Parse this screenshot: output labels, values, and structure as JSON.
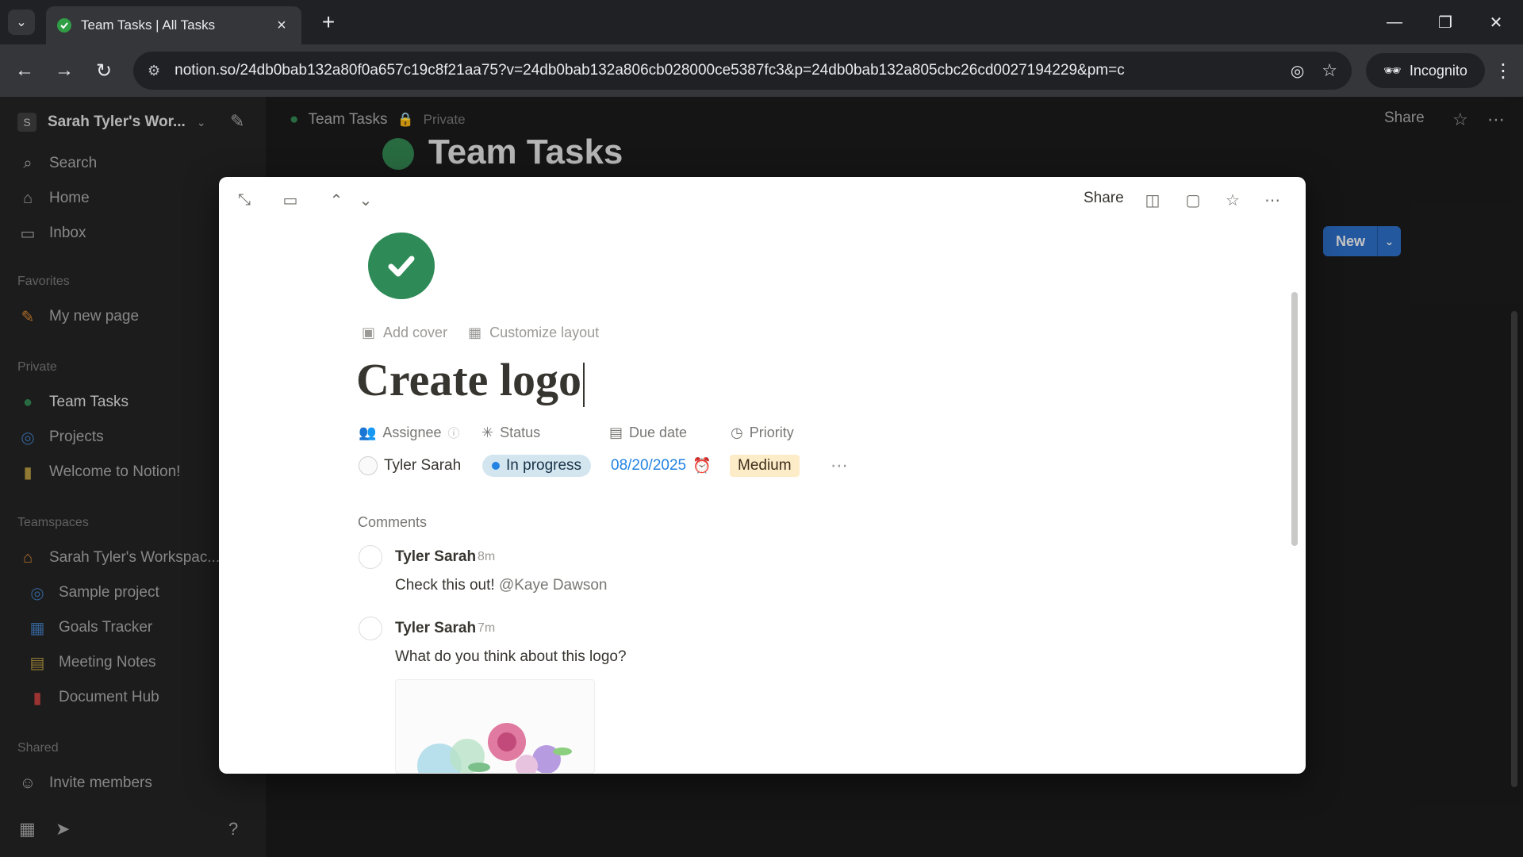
{
  "browser": {
    "tab_title": "Team Tasks | All Tasks",
    "url": "notion.so/24db0bab132a80f0a657c19c8f21aa75?v=24db0bab132a806cb028000ce5387fc3&p=24db0bab132a805cbc26cd0027194229&pm=c",
    "incognito_label": "Incognito"
  },
  "sidebar": {
    "workspace_name": "Sarah Tyler's Wor...",
    "workspace_initial": "S",
    "top_items": [
      {
        "label": "Search",
        "icon": "search-icon"
      },
      {
        "label": "Home",
        "icon": "home-icon"
      },
      {
        "label": "Inbox",
        "icon": "inbox-icon"
      }
    ],
    "favorites_label": "Favorites",
    "favorites": [
      {
        "label": "My new page",
        "icon": "pencil-icon"
      }
    ],
    "private_label": "Private",
    "private_items": [
      {
        "label": "Team Tasks",
        "icon": "check-circle-icon"
      },
      {
        "label": "Projects",
        "icon": "target-icon"
      },
      {
        "label": "Welcome to Notion!",
        "icon": "page-icon"
      }
    ],
    "teamspaces_label": "Teamspaces",
    "teamspace_name": "Sarah Tyler's Workspac...",
    "teamspace_items": [
      {
        "label": "Sample project",
        "icon": "target-icon"
      },
      {
        "label": "Goals Tracker",
        "icon": "chart-icon"
      },
      {
        "label": "Meeting Notes",
        "icon": "calendar-icon"
      },
      {
        "label": "Document Hub",
        "icon": "document-icon"
      }
    ],
    "shared_label": "Shared",
    "invite_label": "Invite members"
  },
  "page": {
    "breadcrumb_title": "Team Tasks",
    "privacy": "Private",
    "heading": "Team Tasks",
    "share": "Share",
    "new_button": "New"
  },
  "modal": {
    "share": "Share",
    "add_cover": "Add cover",
    "customize_layout": "Customize layout",
    "title": "Create logo",
    "properties": {
      "assignee_label": "Assignee",
      "status_label": "Status",
      "due_date_label": "Due date",
      "priority_label": "Priority",
      "assignee_value": "Tyler Sarah",
      "status_value": "In progress",
      "due_date_value": "08/20/2025",
      "priority_value": "Medium"
    },
    "comments_label": "Comments",
    "comments": [
      {
        "author": "Tyler Sarah",
        "time": "8m",
        "text": "Check this out!",
        "mention": "@Kaye Dawson"
      },
      {
        "author": "Tyler Sarah",
        "time": "7m",
        "text": "What do you think about this logo?"
      }
    ]
  },
  "colors": {
    "accent_blue": "#2383e2",
    "check_green": "#2e8b57",
    "status_pill": "#d3e5ef",
    "priority_pill": "#fdecc8"
  }
}
